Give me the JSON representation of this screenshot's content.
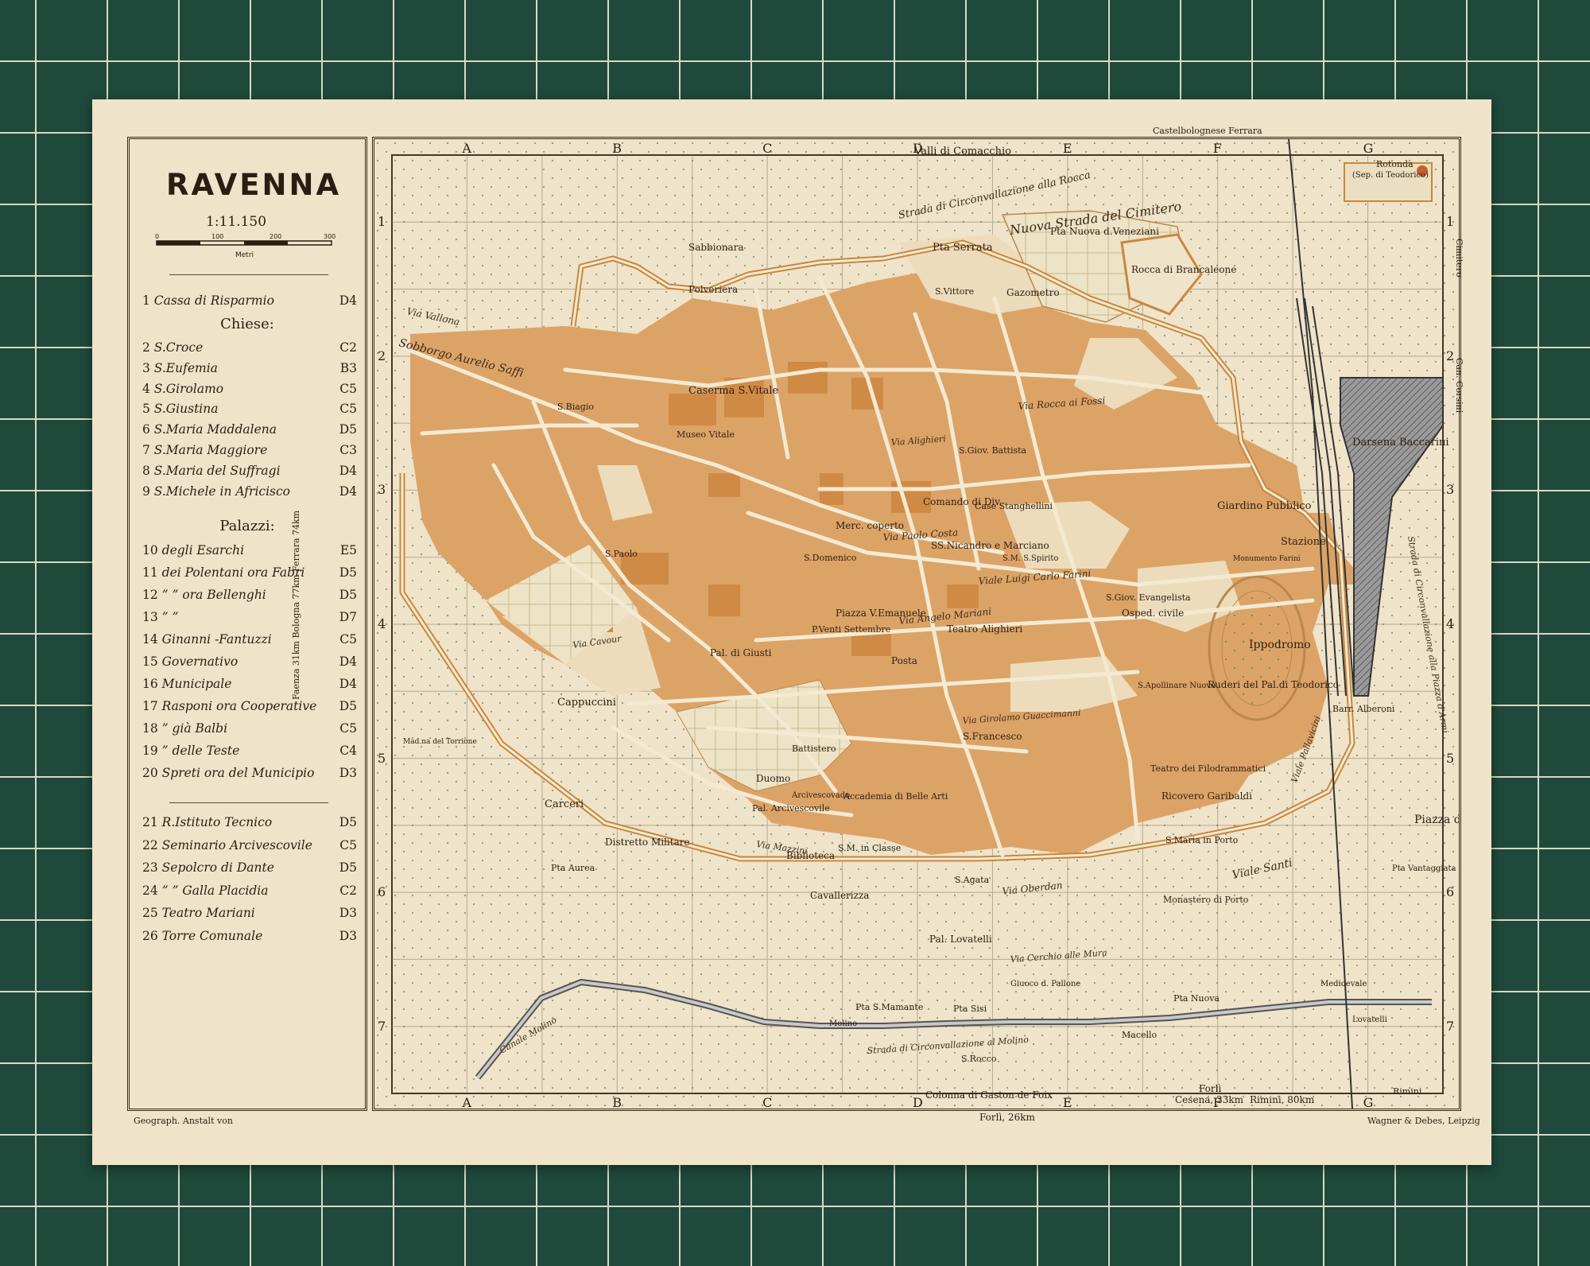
{
  "map": {
    "title": "RAVENNA",
    "scale": "1:11.150",
    "scale_bar": {
      "ticks": [
        "0",
        "100",
        "200",
        "300"
      ],
      "unit": "Metri"
    },
    "legend": {
      "top": [
        {
          "num": "1",
          "name": "Cassa di Risparmio",
          "code": "D4"
        }
      ],
      "chiese_head": "Chiese:",
      "chiese": [
        {
          "num": "2",
          "name": "S.Croce",
          "code": "C2"
        },
        {
          "num": "3",
          "name": "S.Eufemia",
          "code": "B3"
        },
        {
          "num": "4",
          "name": "S.Girolamo",
          "code": "C5"
        },
        {
          "num": "5",
          "name": "S.Giustina",
          "code": "C5"
        },
        {
          "num": "6",
          "name": "S.Maria Maddalena",
          "code": "D5"
        },
        {
          "num": "7",
          "name": "S.Maria Maggiore",
          "code": "C3"
        },
        {
          "num": "8",
          "name": "S.Maria del Suffragi",
          "code": "D4"
        },
        {
          "num": "9",
          "name": "S.Michele in Africisco",
          "code": "D4"
        }
      ],
      "palazzi_head": "Palazzi:",
      "palazzi": [
        {
          "num": "10",
          "name": "degli Esarchi",
          "code": "E5"
        },
        {
          "num": "11",
          "name": "dei Polentani ora Fabri",
          "code": "D5"
        },
        {
          "num": "12",
          "name": "” ” ora Bellenghi",
          "code": "D5"
        },
        {
          "num": "13",
          "name": "” ”",
          "code": "D7"
        },
        {
          "num": "14",
          "name": "Ginanni -Fantuzzi",
          "code": "C5"
        },
        {
          "num": "15",
          "name": "Governativo",
          "code": "D4"
        },
        {
          "num": "16",
          "name": "Municipale",
          "code": "D4"
        },
        {
          "num": "17",
          "name": "Rasponi ora Cooperative",
          "code": "D5"
        },
        {
          "num": "18",
          "name": "” già Balbi",
          "code": "C5"
        },
        {
          "num": "19",
          "name": "” delle Teste",
          "code": "C4"
        },
        {
          "num": "20",
          "name": "Spreti ora del Municipio",
          "code": "D3"
        }
      ],
      "others": [
        {
          "num": "21",
          "name": "R.Istituto Tecnico",
          "code": "D5"
        },
        {
          "num": "22",
          "name": "Seminario Arcivescovile",
          "code": "C5"
        },
        {
          "num": "23",
          "name": "Sepolcro di Dante",
          "code": "D5"
        },
        {
          "num": "24",
          "name": "” ” Galla Placidia",
          "code": "C2"
        },
        {
          "num": "25",
          "name": "Teatro Mariani",
          "code": "D3"
        },
        {
          "num": "26",
          "name": "Torre Comunale",
          "code": "D3"
        }
      ]
    },
    "grid_cols": [
      "A",
      "B",
      "C",
      "D",
      "E",
      "F",
      "G"
    ],
    "grid_rows": [
      "1",
      "2",
      "3",
      "4",
      "5",
      "6",
      "7"
    ],
    "edge_labels": {
      "top_center": "Valli di Comacchio",
      "top_right": "Castelbolognese Ferrara",
      "bottom_center": "Colonna di Gaston de Foix",
      "bottom_right_a": "Forlì",
      "bottom_right_b": "Cesena, 33km",
      "bottom_right_c": "Rimini, 80km",
      "bottom_far_right": "Rimini",
      "left_vertical": "Faenza 31km  Bologna 77km  Ferrara 74km",
      "right_vertical_1": "Cimitero",
      "right_vertical_2": "Can. Corsini",
      "below_map": "Forlì, 26km"
    },
    "footer": {
      "left": "Geograph. Anstalt von",
      "right": "Wagner & Debes, Leipzig"
    },
    "places": {
      "rotonda": "Rotonda",
      "sep_teodorico": "(Sep. di Teodorico)",
      "sabbionara": "Sabbionara",
      "polveriera": "Polveriera",
      "p_serrata": "Pta Serrata",
      "p_nuova_venezian": "Pta Nuova d.Veneziani",
      "rocca": "Rocca di Brancaleone",
      "gazometro": "Gazometro",
      "s_vittore": "S.Vittore",
      "caserma": "Caserma S.Vitale",
      "museo_vitale": "Museo Vitale",
      "s_biagio": "S.Biagio",
      "darsena": "Darsena Baccarini",
      "s_giov_battista": "S.Giov. Battista",
      "giardino": "Giardino Pubblico",
      "stazione": "Stazione",
      "monumento_farini": "Monumento Farini",
      "comando": "Comando di Div.",
      "case_stanghellini": "Case Stanghellini",
      "mercato": "Merc. coperto",
      "nicandro": "SS.Nicandro e Marciano",
      "s_spirito": "S.M. S.Spirito",
      "s_paolo": "S.Paolo",
      "s_domenico": "S.Domenico",
      "piazza_ve": "Piazza V.Emanuele",
      "p_venti_sett": "P.Venti Settembre",
      "teatro_alighieri": "Teatro Alighieri",
      "posta": "Posta",
      "s_giov_evangelista": "S.Giov. Evangelista",
      "ospedale": "Osped. civile",
      "ruderi": "Ruderi del Pal.di Teodorico",
      "s_apollinare": "S.Apollinare Nuovo",
      "pal_giusti": "Pal. di Giusti",
      "cappuccini": "Cappuccini",
      "s_francesco": "S.Francesco",
      "battistero": "Battistero",
      "duomo": "Duomo",
      "arcivescovado": "Arcivescovado",
      "pal_arcivescovile": "Pal. Arcivescovile",
      "accademia": "Accademia di Belle Arti",
      "teatro_filodrammatici": "Teatro dei Filodrammatici",
      "ricovero": "Ricovero Garibaldi",
      "carceri": "Carceri",
      "distretto": "Distretto Militare",
      "porta_aurea": "Pta Aurea",
      "biblioteca": "Biblioteca",
      "s_m_classe": "S.M. in Classe",
      "cavallerizza": "Cavallerizza",
      "s_agata": "S.Agata",
      "s_maria_porto": "S.Maria in Porto",
      "monastero": "Monastero di Porto",
      "ippodromo": "Ippodromo",
      "piazza_armi": "Piazza d'Armi",
      "p_vantaggiata": "Pta Vantaggiata",
      "pal_lovatelli": "Pal. Lovatelli",
      "gioco_pallone": "Giuoco d. Pallone",
      "p_s_mamante": "Pta S.Mamante",
      "p_sisi": "Pta Sisi",
      "p_nuova": "Pta Nuova",
      "macello": "Macello",
      "s_rocco": "S.Rocco",
      "madonna_torrione": "Mad.na del Torrione",
      "alberoni": "Barr. Alberoni",
      "medicevale": "Medioevale",
      "molino": "Molino",
      "lovatelli": "Lovatelli"
    },
    "roads": {
      "nuova_strada_cimitero": "Nuova Strada del Cimitero",
      "circonvallazione_rocca": "Strada di Circonvallazione alla Rocca",
      "via_rocca_fossi": "Via Rocca ai Fossi",
      "aurelio_saffi": "Sobborgo Aurelio Saffi",
      "via_paolo_costa": "Via Paolo Costa",
      "viale_carlo_farini": "Viale Luigi Carlo Farini",
      "via_angelo_mariani": "Via Angelo Mariani",
      "via_girolamo": "Via Girolamo Guaccimanni",
      "viale_santi": "Viale Santi",
      "strada_molino": "Strada di Circonvallazione al Molino",
      "via_oberdan": "Via Oberdan",
      "via_cerchio": "Via Cerchio alle Mura",
      "via_cavour": "Via Cavour",
      "via_mazzini": "Via Mazzini",
      "via_alighieri": "Via Alighieri",
      "via_vallona": "Via Vallona",
      "canale": "Canale Molino",
      "viale_pallavicini": "Viale Pallavicini",
      "circonvallazione_piazza": "Strada di Circonvallazione alla Piazza d'Armi"
    }
  }
}
